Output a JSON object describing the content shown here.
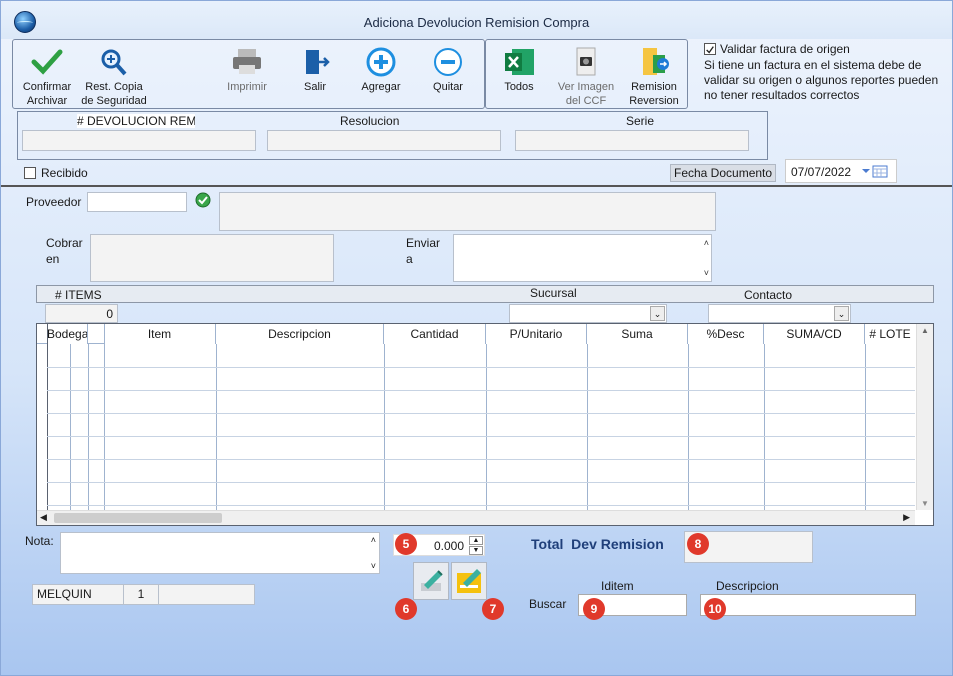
{
  "window": {
    "title": "Adiciona Devolucion Remision Compra"
  },
  "toolbar": {
    "confirm": "Confirmar\nArchivar",
    "backup": "Rest. Copia\nde Seguridad",
    "print": "Imprimir",
    "exit": "Salir",
    "add": "Agregar",
    "remove": "Quitar",
    "all": "Todos",
    "view_image": "Ver Imagen\ndel CCF",
    "remision": "Remision\nReversion"
  },
  "validate": {
    "label": "Validar factura de origen",
    "checked": true,
    "note": "Si tiene un factura en el sistema debe de validar su origen o algunos reportes pueden no tener resultados correctos"
  },
  "header_fields": {
    "devolucion_label": "# DEVOLUCION REM",
    "resolucion_label": "Resolucion",
    "serie_label": "Serie"
  },
  "recibido": {
    "label": "Recibido",
    "checked": false
  },
  "fecha": {
    "label": "Fecha Documento",
    "value": "07/07/2022"
  },
  "proveedor": {
    "label": "Proveedor"
  },
  "cobrar": {
    "label": "Cobrar\nen"
  },
  "enviar": {
    "label": "Enviar\na"
  },
  "items": {
    "label": "# ITEMS",
    "count": "0",
    "sucursal_label": "Sucursal",
    "contacto_label": "Contacto"
  },
  "grid": {
    "columns": [
      "Bodega",
      "Item",
      "Descripcion",
      "Cantidad",
      "P/Unitario",
      "Suma",
      "%Desc",
      "SUMA/CD",
      "# LOTE"
    ]
  },
  "nota": {
    "label": "Nota:"
  },
  "status": {
    "user": "MELQUIN",
    "number": "1"
  },
  "spinner": {
    "value": "0.000"
  },
  "total": {
    "label": "Total  Dev Remision"
  },
  "buscar": {
    "label": "Buscar",
    "iditem_label": "Iditem",
    "descripcion_label": "Descripcion"
  },
  "badges": {
    "b5": "5",
    "b6": "6",
    "b7": "7",
    "b8": "8",
    "b9": "9",
    "b10": "10"
  },
  "colors": {
    "accent_red": "#e0392b",
    "title_blue": "#1f3f7a"
  }
}
